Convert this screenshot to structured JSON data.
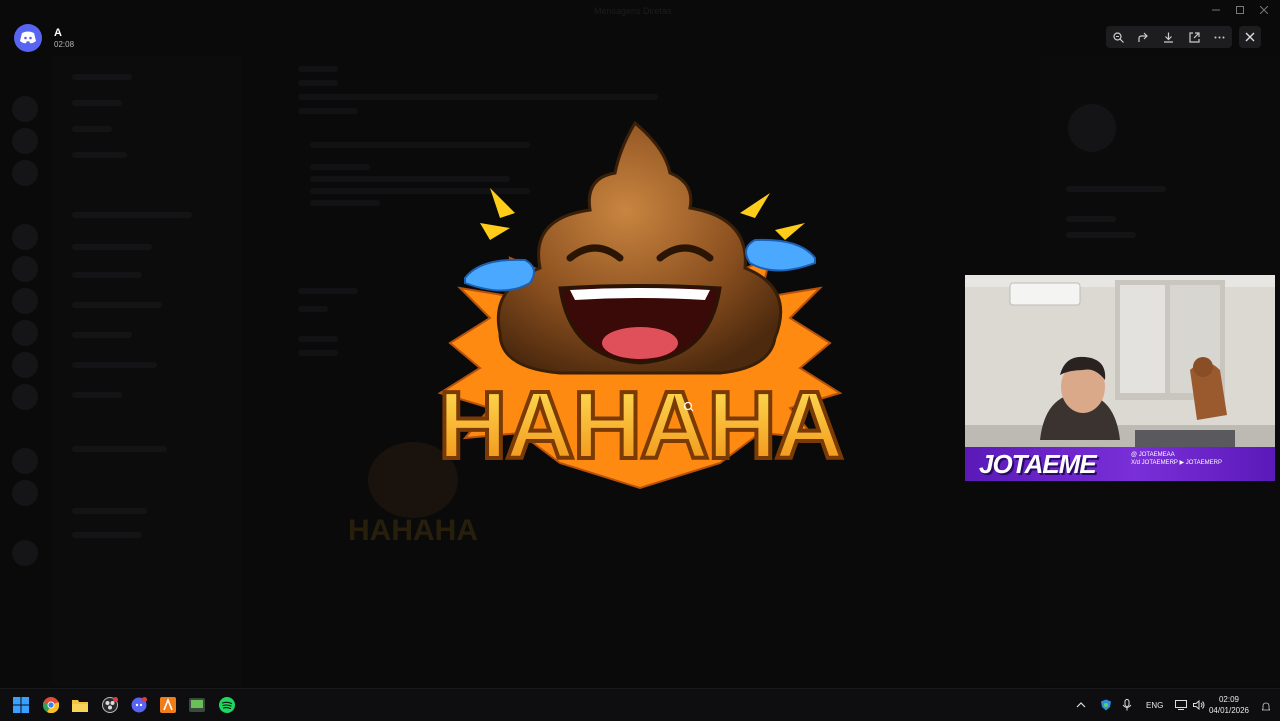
{
  "window": {
    "title": "Mensagens Diretas"
  },
  "viewer": {
    "user_name": "A",
    "timestamp": "02:08",
    "tools": [
      {
        "icon": "zoom-icon"
      },
      {
        "icon": "forward-icon"
      },
      {
        "icon": "download-icon"
      },
      {
        "icon": "open-in-browser-icon"
      },
      {
        "icon": "more-icon"
      }
    ],
    "close_icon": "close-icon"
  },
  "image": {
    "caption": "HAHAHA",
    "colors": {
      "poop": "#8a4f1f",
      "text": "#f5b41a",
      "tears": "#4aa8ff",
      "burst": "#ff8a12"
    }
  },
  "webcam": {
    "name": "JOTAEME",
    "socials": [
      "@ JOTAEMEAA",
      "X/d JOTAEMERP  ▶ JOTAEMERP"
    ]
  },
  "taskbar": {
    "apps": [
      {
        "icon": "windows-start-icon"
      },
      {
        "icon": "chrome-icon"
      },
      {
        "icon": "file-explorer-icon"
      },
      {
        "icon": "obs-icon"
      },
      {
        "icon": "discord-icon"
      },
      {
        "icon": "app-orange-icon"
      },
      {
        "icon": "app-green-icon"
      },
      {
        "icon": "spotify-icon"
      }
    ],
    "language": "ENG",
    "clock_time": "02:09",
    "clock_date": "04/01/2026"
  }
}
